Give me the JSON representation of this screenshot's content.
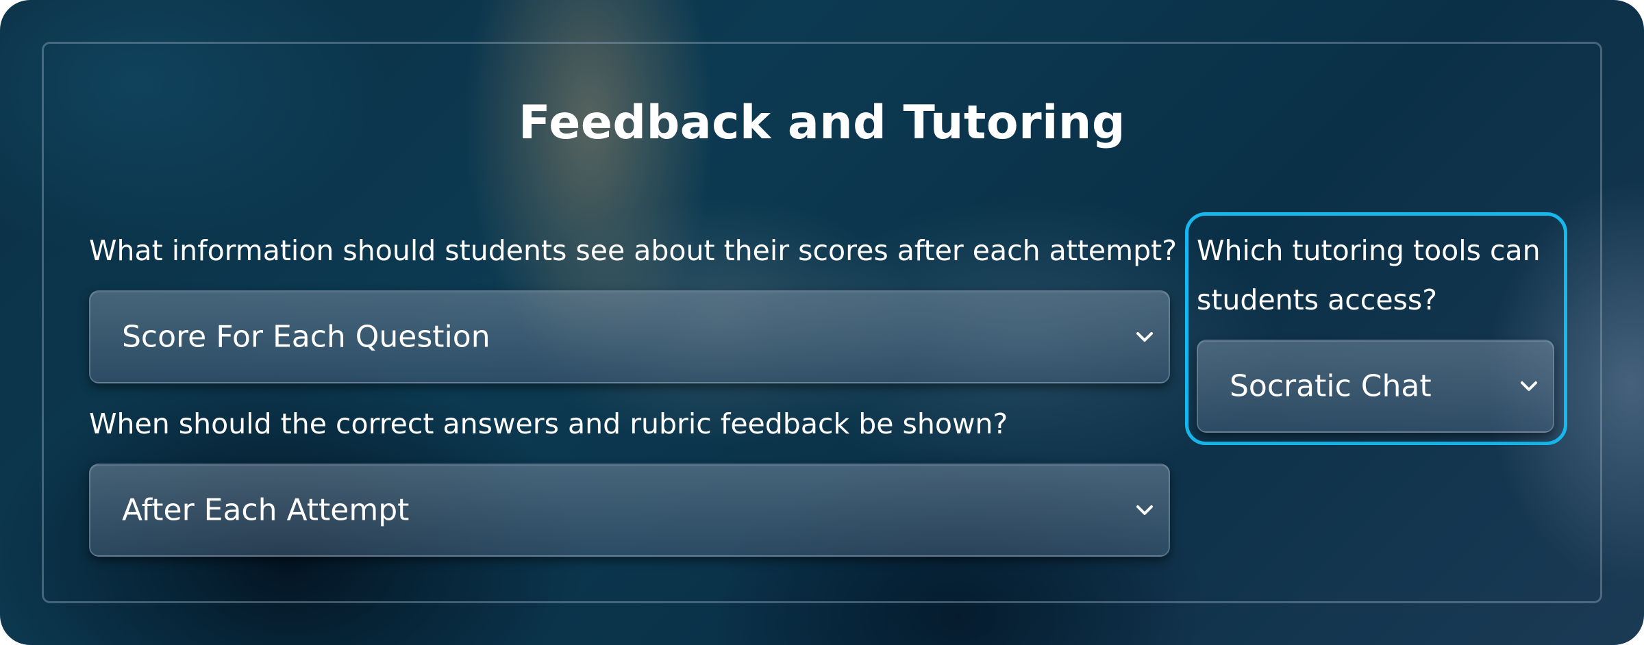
{
  "title": "Feedback and Tutoring",
  "scores_question": {
    "label": "What information should students see about their scores after each attempt?",
    "selected": "Score For Each Question"
  },
  "answers_question": {
    "label": "When should the correct answers and rubric feedback be shown?",
    "selected": "After Each Attempt"
  },
  "tutoring_question": {
    "label_line1": "Which tutoring tools can",
    "label_line2": "students access?",
    "selected": "Socratic Chat"
  },
  "icons": {
    "dropdown": "chevron-down-icon"
  },
  "colors": {
    "highlight": "#16b8ee",
    "text": "#ffffff"
  }
}
